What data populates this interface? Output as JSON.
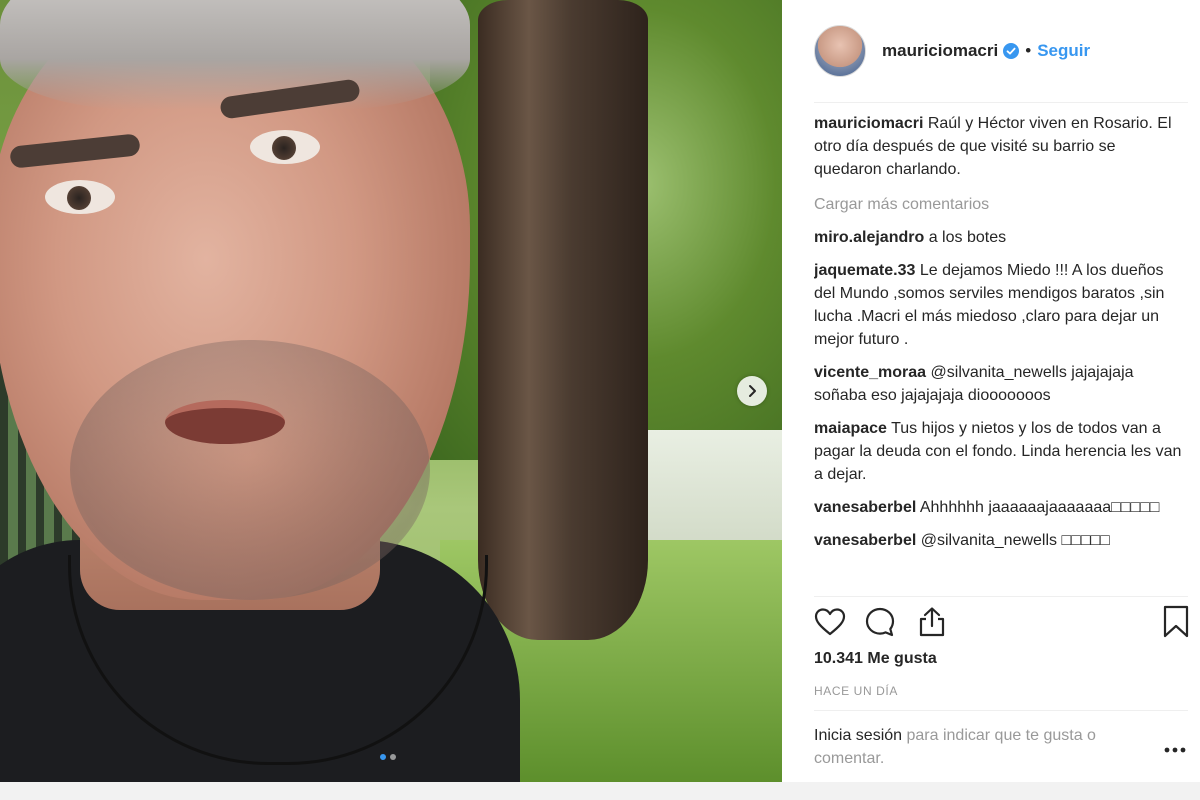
{
  "post": {
    "username": "mauriciomacri",
    "separator": "•",
    "follow_label": "Seguir"
  },
  "caption": {
    "username": "mauriciomacri",
    "text": "Raúl y Héctor viven en Rosario. El otro día después de que visité su barrio se quedaron charlando."
  },
  "load_more_label": "Cargar más comentarios",
  "comments": [
    {
      "username": "miro.alejandro",
      "text": "a los botes"
    },
    {
      "username": "jaquemate.33",
      "text": "Le dejamos Miedo !!! A los dueños del Mundo ,somos serviles mendigos baratos ,sin lucha .Macri el más miedoso ,claro para dejar un mejor futuro ."
    },
    {
      "username": "vicente_moraa",
      "text": "@silvanita_newells jajajajaja soñaba eso jajajajaja diooooooos"
    },
    {
      "username": "maiapace",
      "text": "Tus hijos y nietos y los de todos van a pagar la deuda con el fondo. Linda herencia les van a dejar."
    },
    {
      "username": "vanesaberbel",
      "text": "Ahhhhhh jaaaaaajaaaaaaa□□□□□"
    },
    {
      "username": "vanesaberbel",
      "text": "@silvanita_newells □□□□□"
    }
  ],
  "likes_text": "10.341 Me gusta",
  "time_text": "HACE UN DÍA",
  "login": {
    "link": "Inicia sesión",
    "text": " para indicar que te gusta o comentar."
  },
  "colors": {
    "accent": "#3897f0",
    "muted": "#999999",
    "text": "#262626"
  },
  "carousel": {
    "current": 1,
    "total": 2
  },
  "icons": [
    "verified-badge-icon",
    "chevron-right-icon",
    "heart-icon",
    "comment-icon",
    "share-icon",
    "bookmark-icon",
    "more-options-icon"
  ]
}
